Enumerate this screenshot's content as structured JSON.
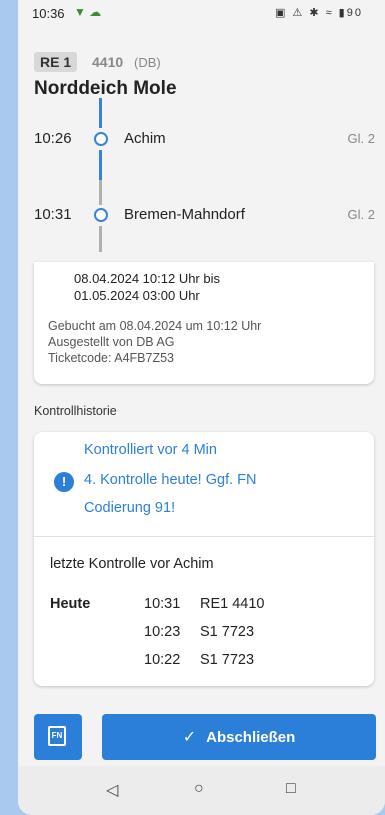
{
  "status_bar": {
    "time": "10:36",
    "battery": "90"
  },
  "train": {
    "badge": "RE 1",
    "number": "4410",
    "operator": "(DB)",
    "destination": "Norddeich Mole"
  },
  "stops": [
    {
      "time": "10:26",
      "name": "Achim",
      "platform": "Gl. 2"
    },
    {
      "time": "10:31",
      "name": "Bremen-Mahndorf",
      "platform": "Gl. 2"
    }
  ],
  "ticket": {
    "valid_line1": "08.04.2024 10:12 Uhr bis",
    "valid_line2": "01.05.2024 03:00 Uhr",
    "booked": "Gebucht am 08.04.2024 um 10:12 Uhr",
    "issued": "Ausgestellt von DB AG",
    "code": "Ticketcode: A4FB7Z53"
  },
  "control_history": {
    "title": "Kontrollhistorie",
    "warning_line1": "Kontrolliert vor 4 Min",
    "warning_line2": "4. Kontrolle heute! Ggf. FN",
    "warning_line3": "Codierung 91!",
    "last_label": "letzte Kontrolle vor Achim",
    "day": "Heute",
    "entries": [
      {
        "time": "10:31",
        "train": "RE1 4410"
      },
      {
        "time": "10:23",
        "train": "S1 7723"
      },
      {
        "time": "10:22",
        "train": "S1 7723"
      }
    ]
  },
  "actions": {
    "fn_label": "FN",
    "close_label": "Abschließen"
  }
}
